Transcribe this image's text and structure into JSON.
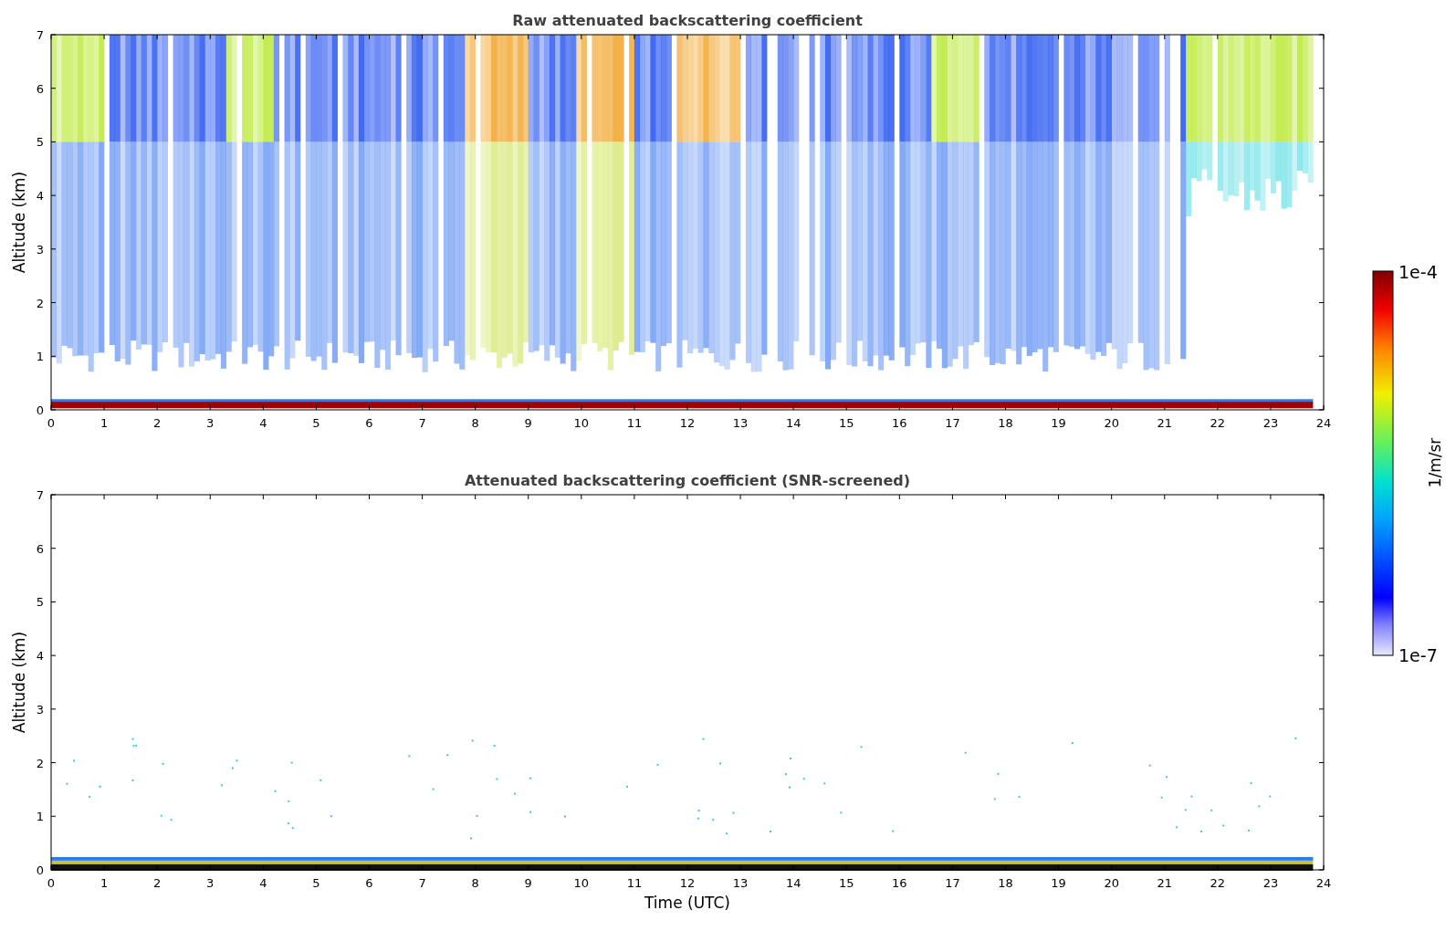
{
  "panels": [
    {
      "kind": "raw",
      "title": "Raw attenuated backscattering coefficient",
      "ylabel": "Altitude (km)",
      "yticks": [
        "7",
        "6",
        "5",
        "4",
        "3",
        "2",
        "1",
        "0"
      ],
      "xticks": [
        "0",
        "1",
        "2",
        "3",
        "4",
        "5",
        "6",
        "7",
        "8",
        "9",
        "10",
        "11",
        "12",
        "13",
        "14",
        "15",
        "16",
        "17",
        "18",
        "19",
        "20",
        "21",
        "22",
        "23",
        "24"
      ]
    },
    {
      "kind": "screened",
      "title": "Attenuated backscattering coefficient (SNR-screened)",
      "ylabel": "Altitude (km)",
      "yticks": [
        "7",
        "6",
        "5",
        "4",
        "3",
        "2",
        "1",
        "0"
      ],
      "xticks": [
        "0",
        "1",
        "2",
        "3",
        "4",
        "5",
        "6",
        "7",
        "8",
        "9",
        "10",
        "11",
        "12",
        "13",
        "14",
        "15",
        "16",
        "17",
        "18",
        "19",
        "20",
        "21",
        "22",
        "23",
        "24"
      ],
      "xlabel": "Time (UTC)"
    }
  ],
  "colorbar": {
    "max_label": "1e-4",
    "min_label": "1e-7",
    "label": "1/m/sr"
  }
}
